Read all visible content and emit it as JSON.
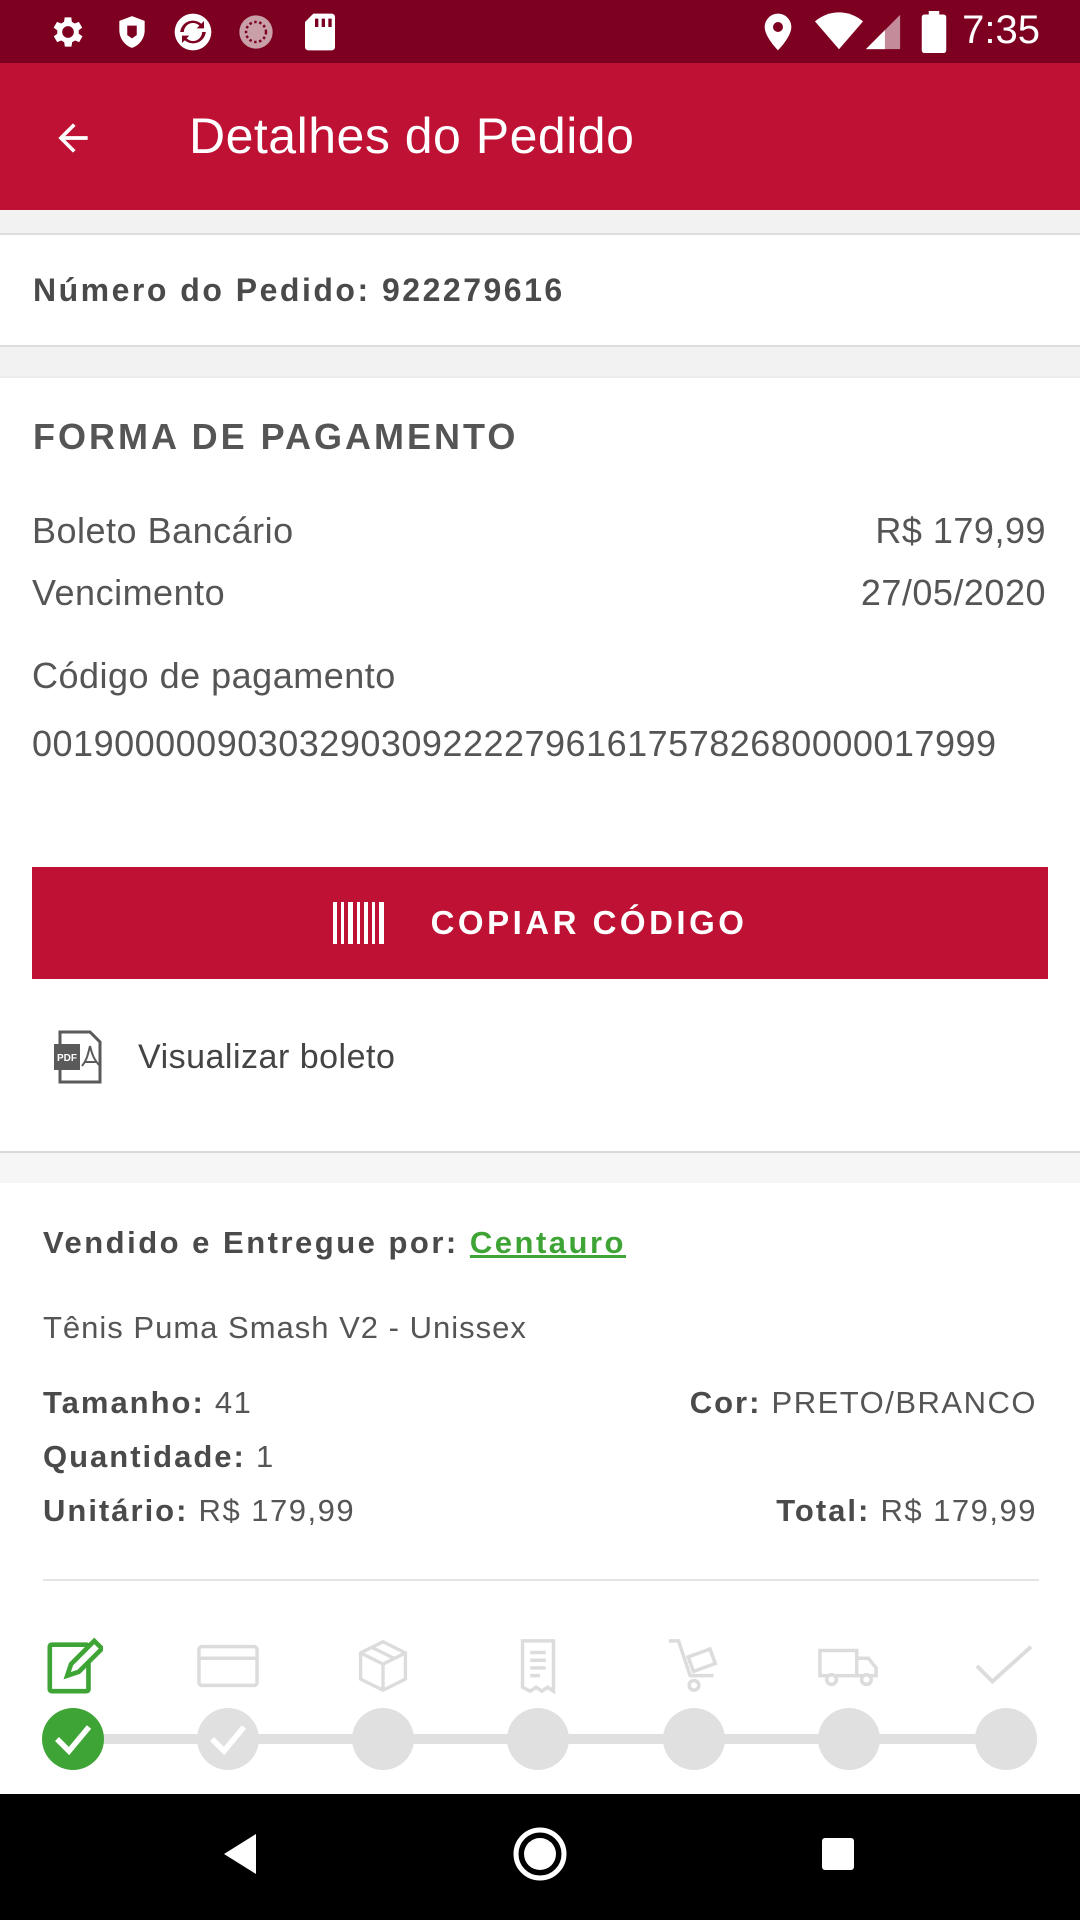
{
  "status_bar": {
    "time": "7:35",
    "icons": [
      "settings-icon",
      "shield-icon",
      "sync-icon",
      "circle-dots-icon",
      "sd-card-icon",
      "location-icon",
      "wifi-icon",
      "signal-icon",
      "battery-icon"
    ]
  },
  "app_bar": {
    "title": "Detalhes do Pedido",
    "back_icon": "arrow-left-icon"
  },
  "order": {
    "number_label": "Número do Pedido: 922279616"
  },
  "payment": {
    "section_title": "FORMA DE PAGAMENTO",
    "method_label": "Boleto Bancário",
    "method_value": "R$ 179,99",
    "due_label": "Vencimento",
    "due_value": "27/05/2020",
    "code_label": "Código de pagamento",
    "code_value": "00190000090303290309222279616175782680000017999",
    "copy_button": "COPIAR CÓDIGO",
    "view_boleto": "Visualizar boleto"
  },
  "seller": {
    "prefix": "Vendido e Entregue por: ",
    "name": "Centauro"
  },
  "product": {
    "name": "Tênis Puma Smash V2 - Unissex",
    "size_label": "Tamanho:",
    "size_value": " 41",
    "color_label": "Cor:",
    "color_value": " PRETO/BRANCO",
    "qty_label": "Quantidade:",
    "qty_value": " 1",
    "unit_label": "Unitário:",
    "unit_value": " R$ 179,99",
    "total_label": "Total:",
    "total_value": " R$ 179,99"
  },
  "tracking": {
    "steps": [
      "order-edit-icon",
      "card-icon",
      "box-icon",
      "invoice-icon",
      "cart-icon",
      "truck-icon",
      "check-icon"
    ],
    "completed_steps": 1,
    "colors": {
      "done": "#3fa436",
      "pending": "#e0e0e0"
    }
  },
  "colors": {
    "primary": "#be1133",
    "status_bar": "#7d0020",
    "link": "#3fa436"
  },
  "nav_bar": {
    "icons": [
      "back-triangle-icon",
      "home-circle-icon",
      "recents-square-icon"
    ]
  }
}
